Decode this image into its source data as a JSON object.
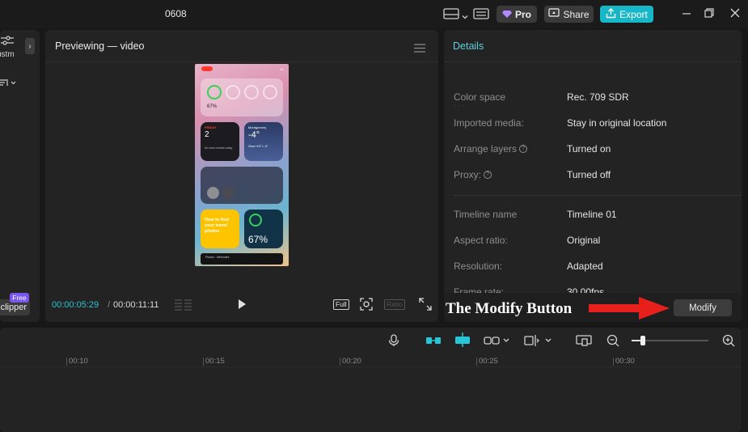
{
  "titlebar": {
    "title": "0608",
    "pro_label": "Pro",
    "share_label": "Share",
    "export_label": "Export"
  },
  "left_panel": {
    "adjust_label": "ustm",
    "clipper_label": "clipper",
    "free_badge": "Free"
  },
  "preview": {
    "title": "Previewing — video",
    "time_current": "00:00:05:29",
    "time_separator": "/",
    "time_total": "00:00:11:11",
    "full_label": "Full",
    "ratio_label": "Ratio",
    "phone": {
      "battery_small": "67%",
      "cal_day": "FRIDAY",
      "cal_num": "2",
      "cal_text": "No more events today",
      "weather_city": "Montgomery",
      "weather_temp": "-4°",
      "weather_desc": "Clear H:6° L:-5°",
      "tips_text": "How to find your travel photos",
      "battery_big": "67%",
      "dock_text": "Photos · Memories"
    }
  },
  "details": {
    "title": "Details",
    "rows": [
      {
        "label": "Color space",
        "value": "Rec. 709 SDR",
        "help": false
      },
      {
        "label": "Imported media:",
        "value": "Stay in original location",
        "help": false
      },
      {
        "label": "Arrange layers",
        "value": "Turned on",
        "help": true
      },
      {
        "label": "Proxy:",
        "value": "Turned off",
        "help": true
      },
      {
        "label": "Timeline name",
        "value": "Timeline 01",
        "help": false
      },
      {
        "label": "Aspect ratio:",
        "value": "Original",
        "help": false
      },
      {
        "label": "Resolution:",
        "value": "Adapted",
        "help": false
      },
      {
        "label": "Frame rate:",
        "value": "30.00fps",
        "help": false
      }
    ],
    "modify_label": "Modify"
  },
  "annotation": {
    "text": "The Modify Button",
    "arrow_color": "#e8201c"
  },
  "timeline": {
    "ticks": [
      "00:10",
      "00:15",
      "00:20",
      "00:25",
      "00:30"
    ]
  },
  "colors": {
    "accent": "#18b7c8",
    "pro_gem": "#b388ff",
    "free_badge": "#7a56f0"
  }
}
